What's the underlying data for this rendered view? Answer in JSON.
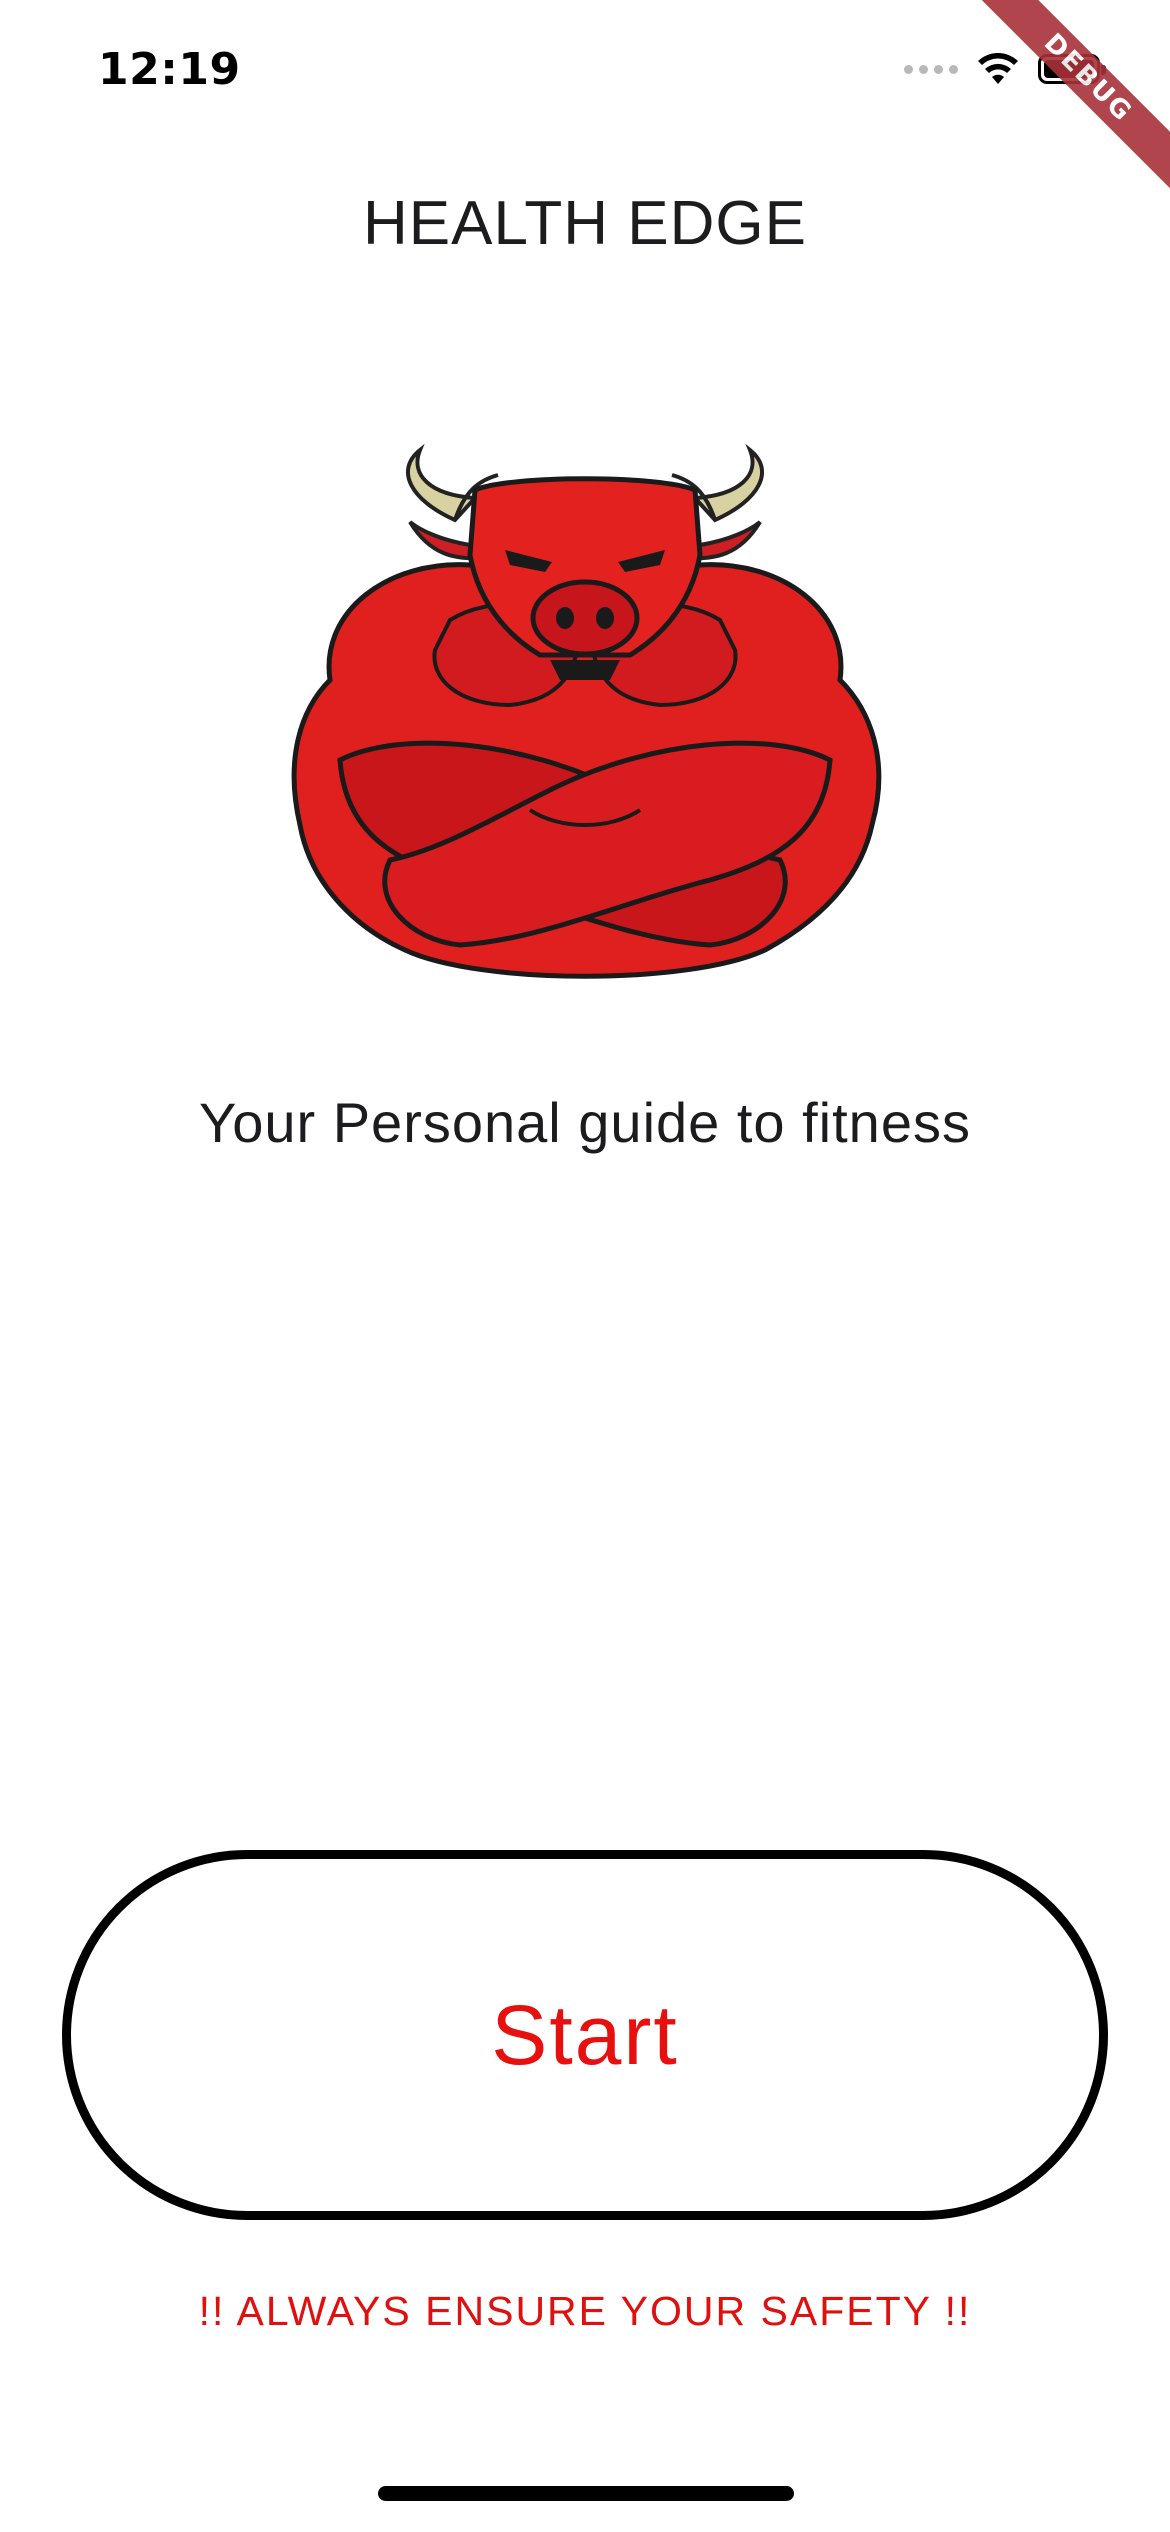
{
  "status_bar": {
    "time": "12:19",
    "icons": [
      "signal-dots-icon",
      "wifi-icon",
      "battery-icon"
    ]
  },
  "debug_banner": "DEBUG",
  "header": {
    "title": "HEALTH EDGE"
  },
  "hero": {
    "image": "muscular-red-bull-mascot"
  },
  "tagline": "Your Personal guide to fitness",
  "actions": {
    "start_label": "Start"
  },
  "safety_note": "!! ALWAYS ENSURE YOUR SAFETY !!",
  "colors": {
    "accent": "#e8100e",
    "button_border": "#000000",
    "debug_ribbon": "#a9313a"
  }
}
